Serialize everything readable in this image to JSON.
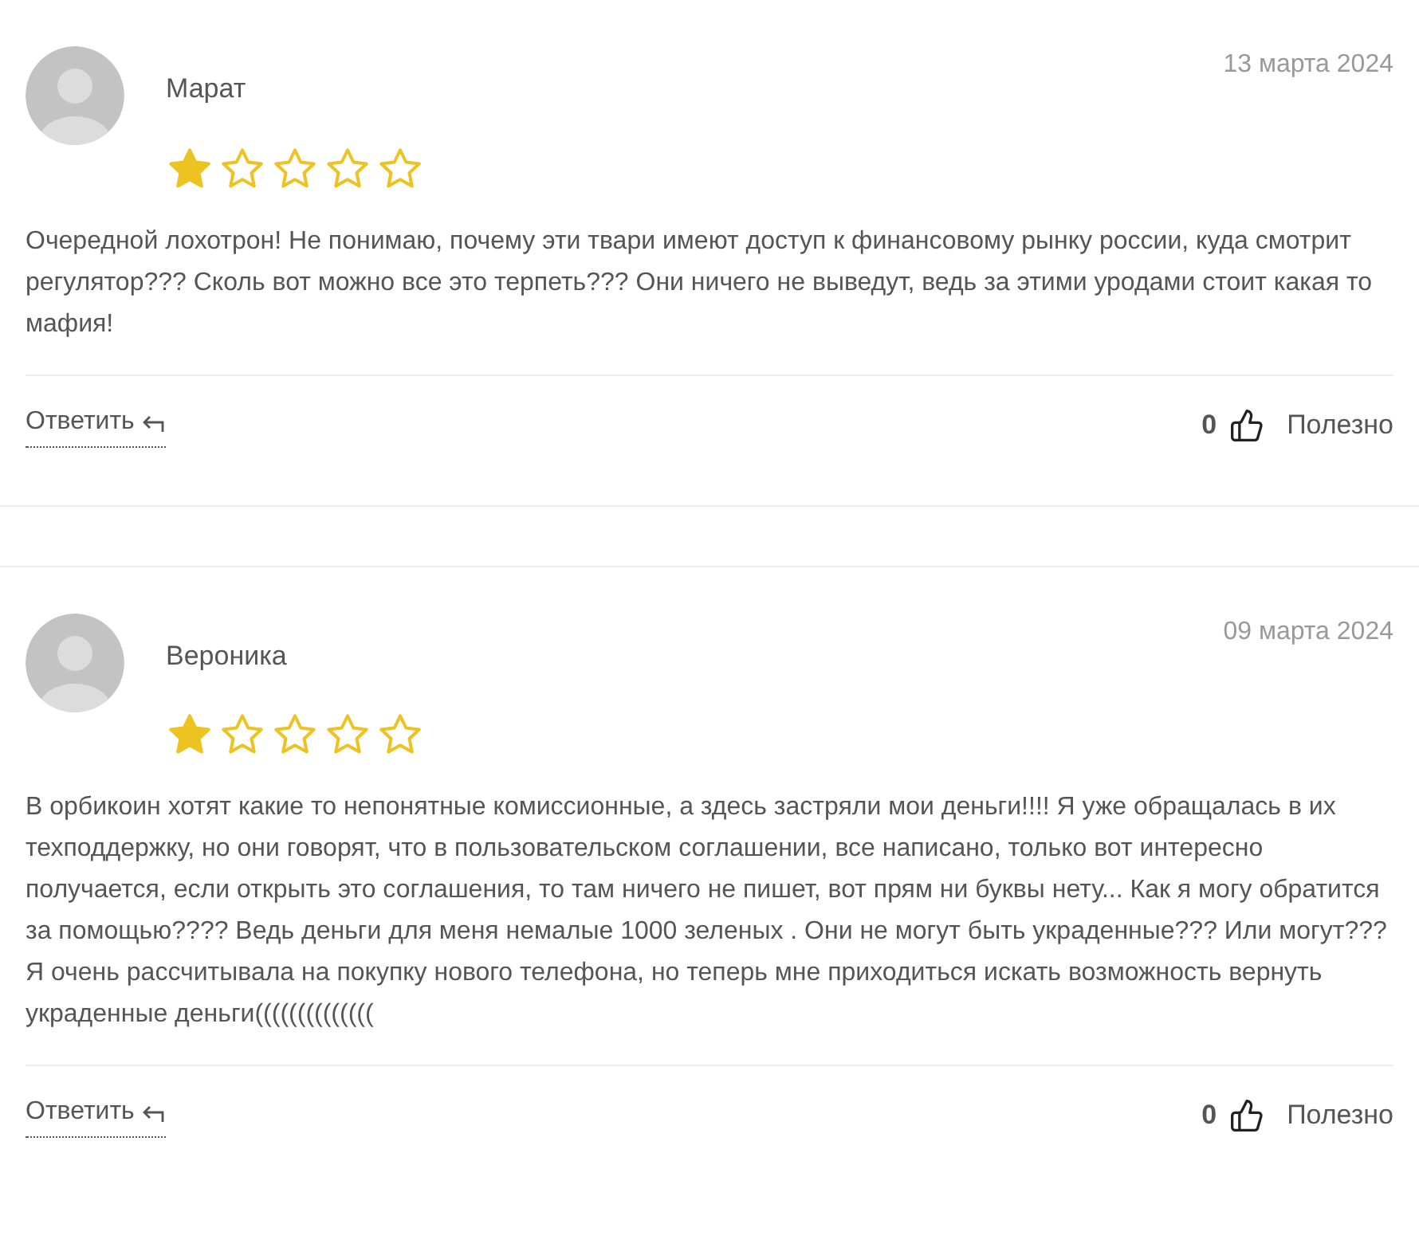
{
  "reviews": [
    {
      "author": "Марат",
      "date": "13 марта 2024",
      "stars": 1,
      "text": "Очередной лохотрон! Не понимаю, почему эти твари имеют доступ к финансовому рынку россии, куда смотрит регулятор??? Сколь вот можно все это терпеть??? Они ничего не выведут, ведь за этими уродами стоит какая то мафия!",
      "reply": "Ответить",
      "likes": "0",
      "helpful": "Полезно"
    },
    {
      "author": "Вероника",
      "date": "09 марта 2024",
      "stars": 1,
      "text": "В орбикоин хотят какие то непонятные комиссионные, а здесь застряли мои деньги!!!! Я уже обращалась в их техподдержку, но они говорят, что в пользовательском соглашении, все написано, только вот интересно получается, если открыть это соглашения, то там ничего не пишет, вот прям ни буквы нету... Как я могу обратится за помощью???? Ведь деньги для меня немалые 1000 зеленых . Они не могут быть украденные??? Или могут??? Я очень рассчитывала на покупку нового телефона, но теперь мне приходиться искать возможность вернуть украденные деньги((((((((((((((",
      "reply": "Ответить",
      "likes": "0",
      "helpful": "Полезно"
    }
  ]
}
